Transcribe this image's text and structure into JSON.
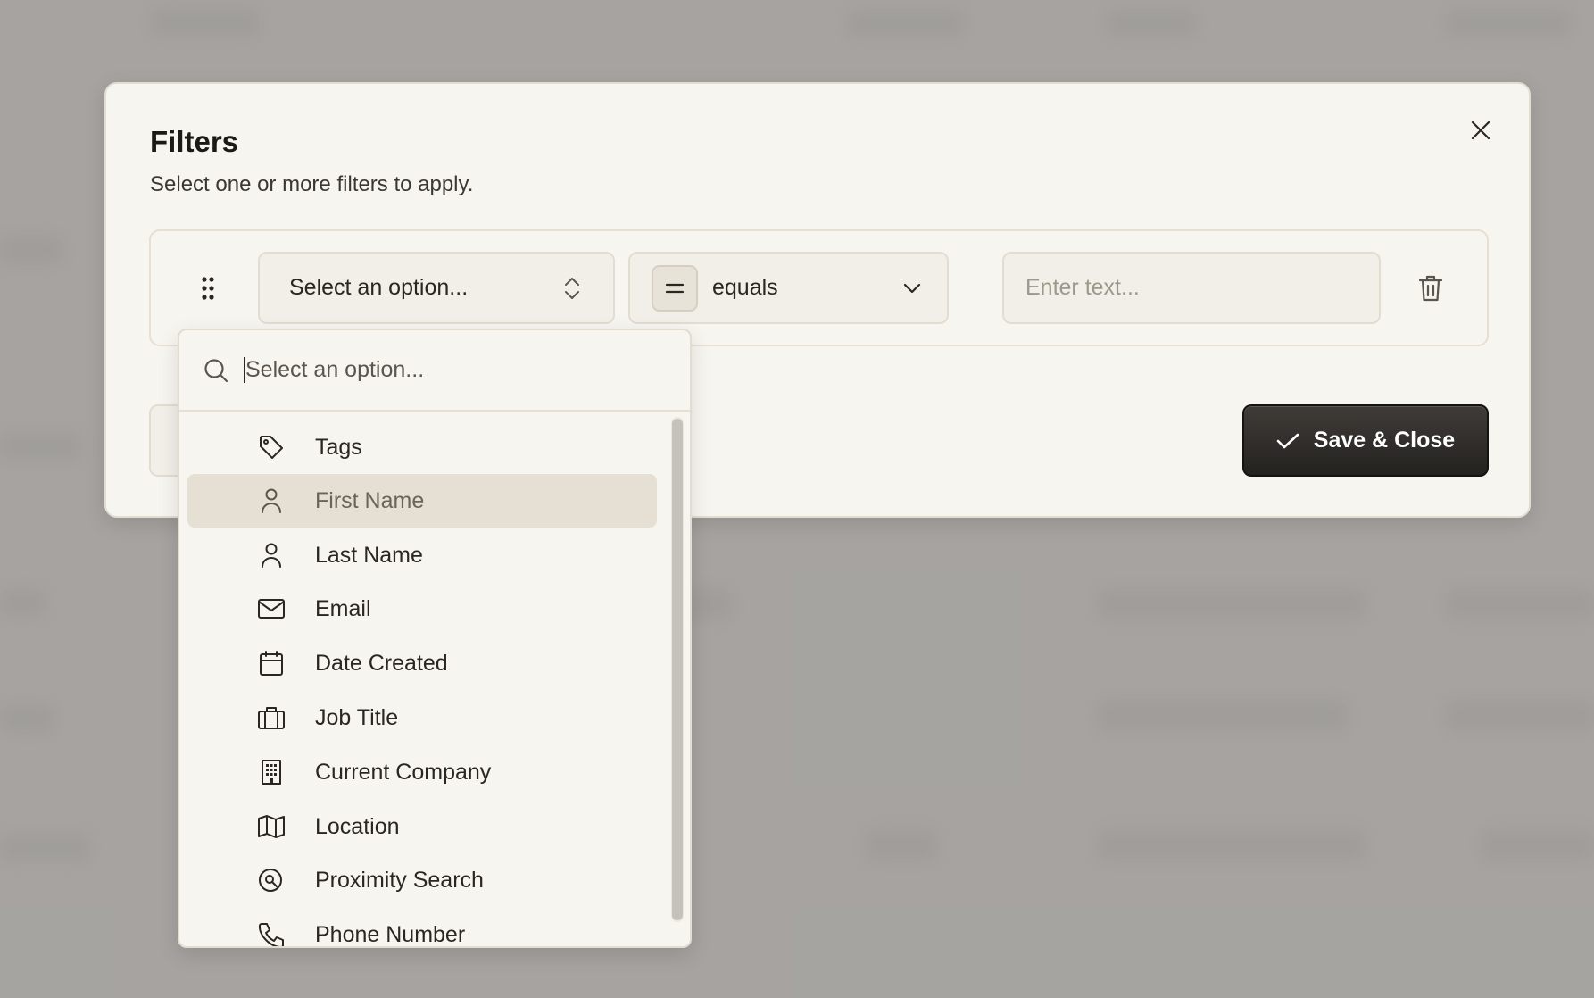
{
  "modal": {
    "title": "Filters",
    "subtitle": "Select one or more filters to apply."
  },
  "filter_row": {
    "field_placeholder": "Select an option...",
    "operator_label": "equals",
    "value_placeholder": "Enter text..."
  },
  "actions": {
    "save_label": "Save & Close"
  },
  "dropdown": {
    "search_placeholder": "Select an option...",
    "items": [
      {
        "label": "Tags",
        "icon": "tag-icon",
        "active": false
      },
      {
        "label": "First Name",
        "icon": "user-icon",
        "active": true
      },
      {
        "label": "Last Name",
        "icon": "user-icon",
        "active": false
      },
      {
        "label": "Email",
        "icon": "mail-icon",
        "active": false
      },
      {
        "label": "Date Created",
        "icon": "calendar-icon",
        "active": false
      },
      {
        "label": "Job Title",
        "icon": "briefcase-icon",
        "active": false
      },
      {
        "label": "Current Company",
        "icon": "building-icon",
        "active": false
      },
      {
        "label": "Location",
        "icon": "map-icon",
        "active": false
      },
      {
        "label": "Proximity Search",
        "icon": "location-search-icon",
        "active": false
      },
      {
        "label": "Phone Number",
        "icon": "phone-icon",
        "active": false
      }
    ]
  },
  "colors": {
    "accent_dark": "#24221f",
    "modal_bg": "#f7f5f0",
    "active_item_bg": "#e6e0d4"
  }
}
